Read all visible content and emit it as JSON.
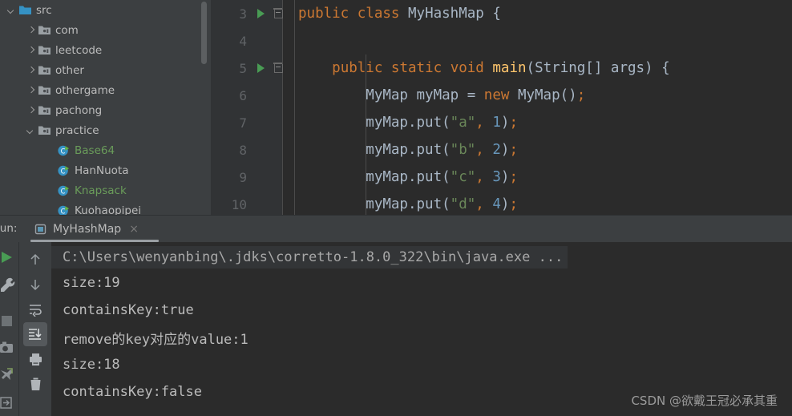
{
  "project_tree": {
    "items": [
      {
        "label": "src",
        "indent": 0,
        "twisty": "down",
        "icon": "folder-blue-icon",
        "color": "default"
      },
      {
        "label": "com",
        "indent": 1,
        "twisty": "right",
        "icon": "folder-package-icon",
        "color": "default"
      },
      {
        "label": "leetcode",
        "indent": 1,
        "twisty": "right",
        "icon": "folder-package-icon",
        "color": "default"
      },
      {
        "label": "other",
        "indent": 1,
        "twisty": "right",
        "icon": "folder-package-icon",
        "color": "default"
      },
      {
        "label": "othergame",
        "indent": 1,
        "twisty": "right",
        "icon": "folder-package-icon",
        "color": "default"
      },
      {
        "label": "pachong",
        "indent": 1,
        "twisty": "right",
        "icon": "folder-package-icon",
        "color": "default"
      },
      {
        "label": "practice",
        "indent": 1,
        "twisty": "down",
        "icon": "folder-package-icon",
        "color": "default"
      },
      {
        "label": "Base64",
        "indent": 2,
        "twisty": "none",
        "icon": "java-class-runnable-icon",
        "color": "green"
      },
      {
        "label": "HanNuota",
        "indent": 2,
        "twisty": "none",
        "icon": "java-class-runnable-icon",
        "color": "default"
      },
      {
        "label": "Knapsack",
        "indent": 2,
        "twisty": "none",
        "icon": "java-class-runnable-icon",
        "color": "green"
      },
      {
        "label": "Kuohaopipei",
        "indent": 2,
        "twisty": "none",
        "icon": "java-class-runnable-icon",
        "color": "default"
      }
    ]
  },
  "editor": {
    "lines": [
      {
        "number": "3",
        "run_marker": true,
        "fold_marker": true,
        "tokens": [
          {
            "text": "public",
            "type": "kw"
          },
          {
            "text": " ",
            "type": "pn"
          },
          {
            "text": "class",
            "type": "kw"
          },
          {
            "text": " ",
            "type": "pn"
          },
          {
            "text": "MyHashMap",
            "type": "id"
          },
          {
            "text": " {",
            "type": "pn"
          }
        ]
      },
      {
        "number": "4",
        "run_marker": false,
        "fold_marker": false,
        "tokens": []
      },
      {
        "number": "5",
        "run_marker": true,
        "fold_marker": true,
        "tokens": [
          {
            "text": "    ",
            "type": "pn"
          },
          {
            "text": "public",
            "type": "kw"
          },
          {
            "text": " ",
            "type": "pn"
          },
          {
            "text": "static",
            "type": "kw"
          },
          {
            "text": " ",
            "type": "pn"
          },
          {
            "text": "void",
            "type": "kw"
          },
          {
            "text": " ",
            "type": "pn"
          },
          {
            "text": "main",
            "type": "mth"
          },
          {
            "text": "(String[] args) {",
            "type": "pn"
          }
        ]
      },
      {
        "number": "6",
        "run_marker": false,
        "fold_marker": false,
        "tokens": [
          {
            "text": "        MyMap myMap = ",
            "type": "id"
          },
          {
            "text": "new",
            "type": "kw"
          },
          {
            "text": " MyMap()",
            "type": "id"
          },
          {
            "text": ";",
            "type": "sc"
          }
        ]
      },
      {
        "number": "7",
        "run_marker": false,
        "fold_marker": false,
        "tokens": [
          {
            "text": "        myMap.put(",
            "type": "id"
          },
          {
            "text": "\"a\"",
            "type": "str"
          },
          {
            "text": ",",
            "type": "sc"
          },
          {
            "text": " ",
            "type": "pn"
          },
          {
            "text": "1",
            "type": "num"
          },
          {
            "text": ")",
            "type": "id"
          },
          {
            "text": ";",
            "type": "sc"
          }
        ]
      },
      {
        "number": "8",
        "run_marker": false,
        "fold_marker": false,
        "tokens": [
          {
            "text": "        myMap.put(",
            "type": "id"
          },
          {
            "text": "\"b\"",
            "type": "str"
          },
          {
            "text": ",",
            "type": "sc"
          },
          {
            "text": " ",
            "type": "pn"
          },
          {
            "text": "2",
            "type": "num"
          },
          {
            "text": ")",
            "type": "id"
          },
          {
            "text": ";",
            "type": "sc"
          }
        ]
      },
      {
        "number": "9",
        "run_marker": false,
        "fold_marker": false,
        "tokens": [
          {
            "text": "        myMap.put(",
            "type": "id"
          },
          {
            "text": "\"c\"",
            "type": "str"
          },
          {
            "text": ",",
            "type": "sc"
          },
          {
            "text": " ",
            "type": "pn"
          },
          {
            "text": "3",
            "type": "num"
          },
          {
            "text": ")",
            "type": "id"
          },
          {
            "text": ";",
            "type": "sc"
          }
        ]
      },
      {
        "number": "10",
        "run_marker": false,
        "fold_marker": false,
        "tokens": [
          {
            "text": "        myMap.put(",
            "type": "id"
          },
          {
            "text": "\"d\"",
            "type": "str"
          },
          {
            "text": ",",
            "type": "sc"
          },
          {
            "text": " ",
            "type": "pn"
          },
          {
            "text": "4",
            "type": "num"
          },
          {
            "text": ")",
            "type": "id"
          },
          {
            "text": ";",
            "type": "sc"
          }
        ]
      }
    ]
  },
  "run_panel": {
    "label": "Run:",
    "tab_label": "MyHashMap",
    "tab_close": "×",
    "toolbar": [
      {
        "name": "rerun-icon",
        "selected": false
      },
      {
        "name": "settings-wrench-icon",
        "selected": false
      },
      {
        "name": "stop-icon",
        "selected": false
      },
      {
        "name": "camera-icon",
        "selected": false
      },
      {
        "name": "pin-icon",
        "selected": false
      },
      {
        "name": "export-icon",
        "selected": false
      }
    ],
    "console_toolbar": [
      {
        "name": "up-arrow-icon",
        "selected": false
      },
      {
        "name": "down-arrow-icon",
        "selected": false
      },
      {
        "name": "soft-wrap-icon",
        "selected": false
      },
      {
        "name": "scroll-to-end-icon",
        "selected": true
      },
      {
        "name": "print-icon",
        "selected": false
      },
      {
        "name": "trash-icon",
        "selected": false
      }
    ],
    "console_output": [
      {
        "text": "C:\\Users\\wenyanbing\\.jdks\\corretto-1.8.0_322\\bin\\java.exe ...",
        "highlighted": true
      },
      {
        "text": "size:19",
        "highlighted": false
      },
      {
        "text": "containsKey:true",
        "highlighted": false
      },
      {
        "text": "remove的key对应的value:1",
        "highlighted": false
      },
      {
        "text": "size:18",
        "highlighted": false
      },
      {
        "text": "containsKey:false",
        "highlighted": false
      }
    ]
  },
  "watermark": "CSDN @欲戴王冠必承其重",
  "colors": {
    "panel_bg": "#3c3f41",
    "editor_bg": "#2b2b2b",
    "gutter_bg": "#313335",
    "keyword": "#cc7832",
    "method": "#ffc66d",
    "string": "#6a8759",
    "number": "#6897bb",
    "identifier": "#a9b7c6",
    "run_green": "#499c54",
    "tree_green": "#6a9c5a"
  }
}
